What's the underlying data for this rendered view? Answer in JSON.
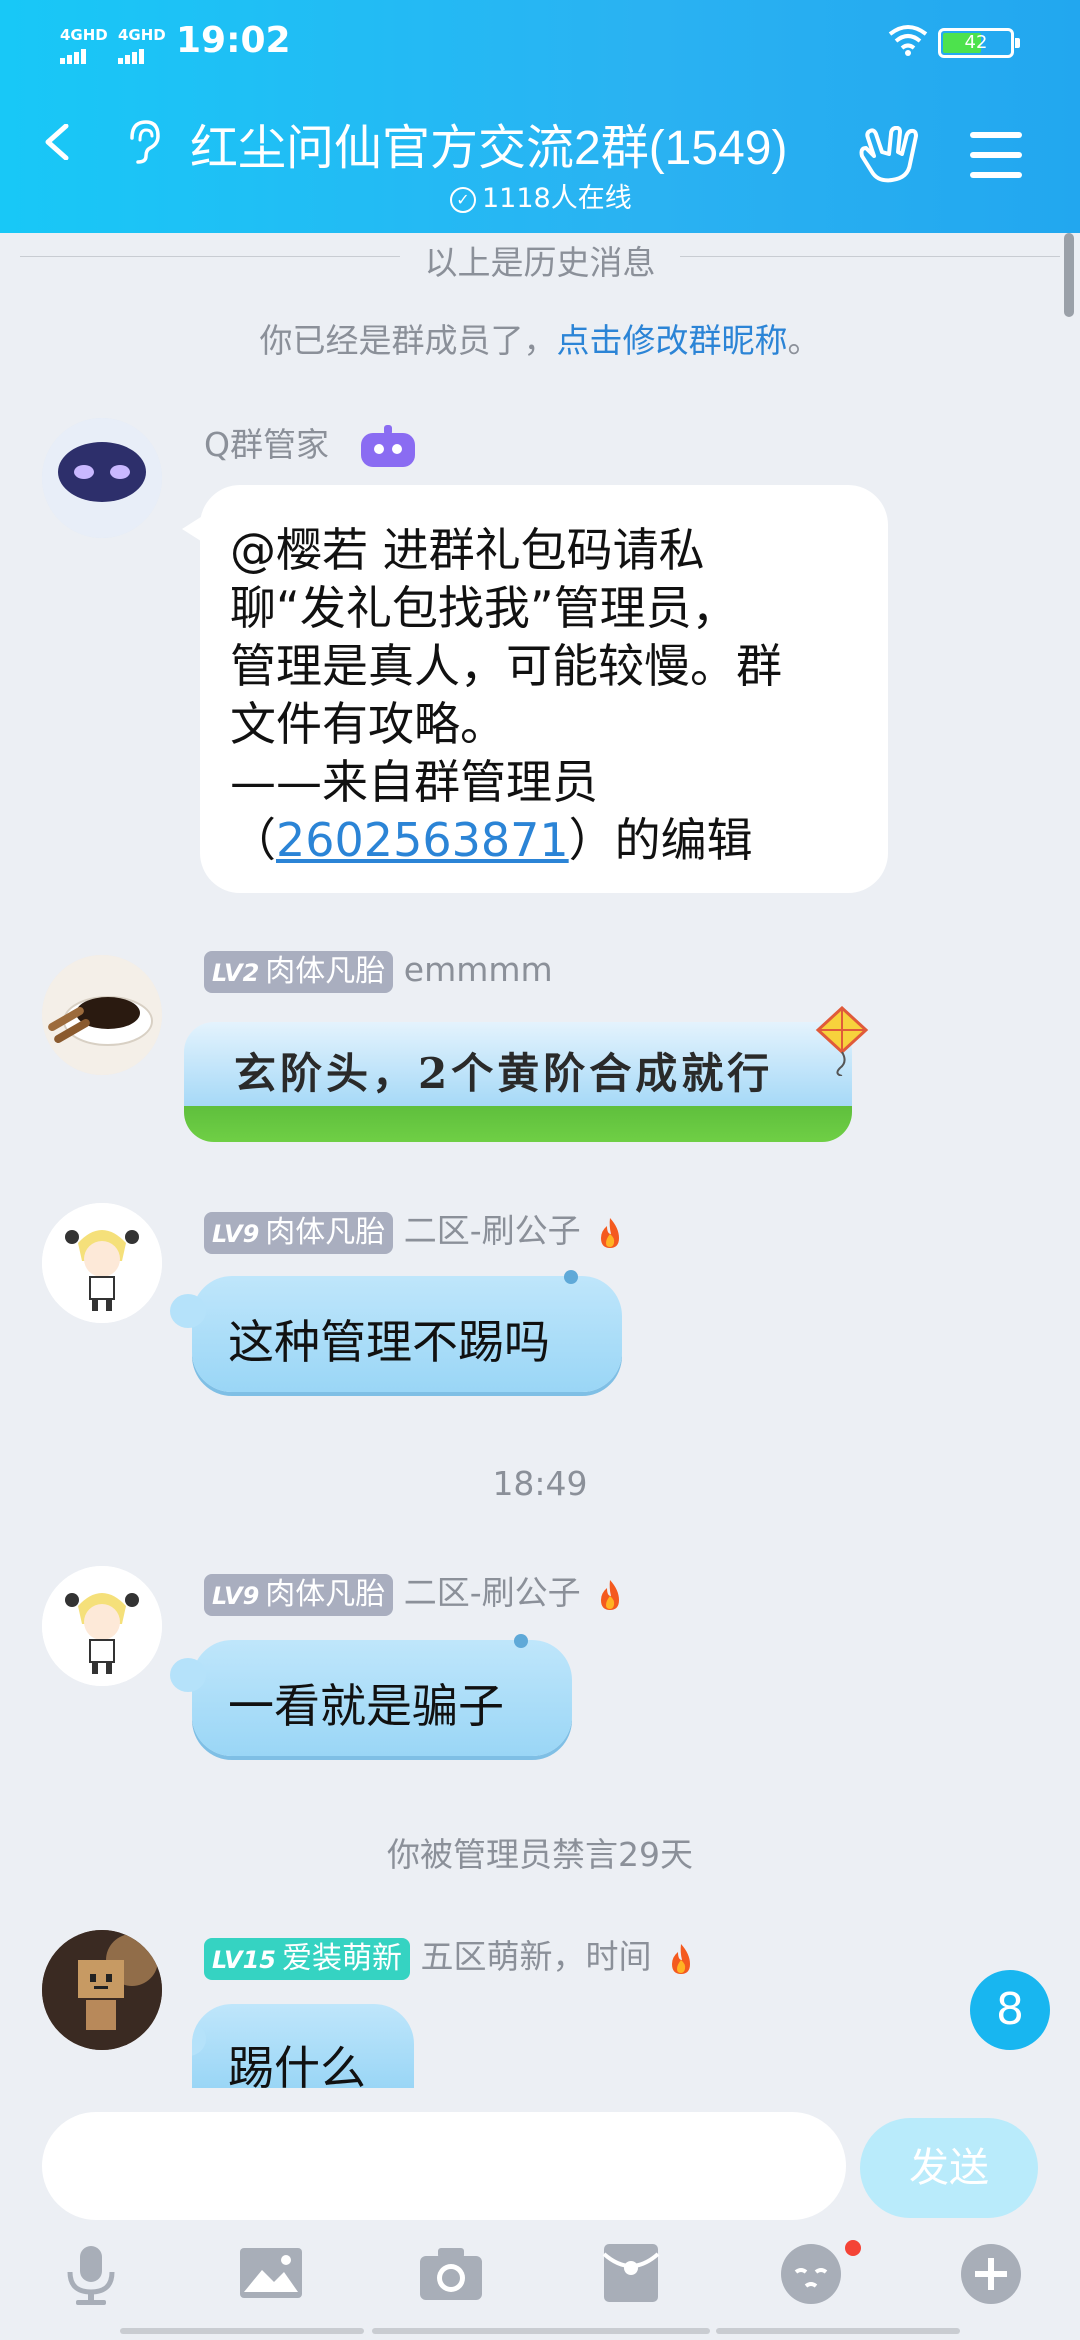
{
  "status": {
    "sig1": "4GHD",
    "sig2": "4GHD",
    "time": "19:02",
    "battery": "42"
  },
  "header": {
    "title": "红尘问仙官方交流2群(1549)",
    "online": "1118人在线"
  },
  "history_label": "以上是历史消息",
  "member_notice": {
    "prefix": "你已经是群成员了，",
    "link": "点击修改群昵称",
    "suffix": "。"
  },
  "messages": [
    {
      "sender": "Q群管家",
      "lines": [
        "@樱若 进群礼包码请私",
        "聊“发礼包找我”管理员，",
        "管理是真人，可能较慢。群",
        "文件有攻略。",
        "——来自群管理员"
      ],
      "last_prefix": "（",
      "uid": "2602563871",
      "last_suffix": "）的编辑"
    },
    {
      "level": "LV2",
      "title": "肉体凡胎",
      "name": "emmmm",
      "text": "玄阶头，2个黄阶合成就行"
    },
    {
      "level": "LV9",
      "title": "肉体凡胎",
      "name": "二区-刷公子",
      "text": "这种管理不踢吗"
    },
    {
      "level": "LV9",
      "title": "肉体凡胎",
      "name": "二区-刷公子",
      "text": "一看就是骗子"
    },
    {
      "level": "LV15",
      "title": "爱装萌新",
      "name": "五区萌新，时间",
      "text": "踢什么"
    }
  ],
  "timestamp": "18:49",
  "mute_notice": "你被管理员禁言29天",
  "unread_count": "8",
  "input": {
    "placeholder": "",
    "send_label": "发送"
  },
  "toolbar": [
    "mic-icon",
    "image-icon",
    "camera-icon",
    "red-packet-icon",
    "emoji-icon",
    "plus-icon"
  ]
}
